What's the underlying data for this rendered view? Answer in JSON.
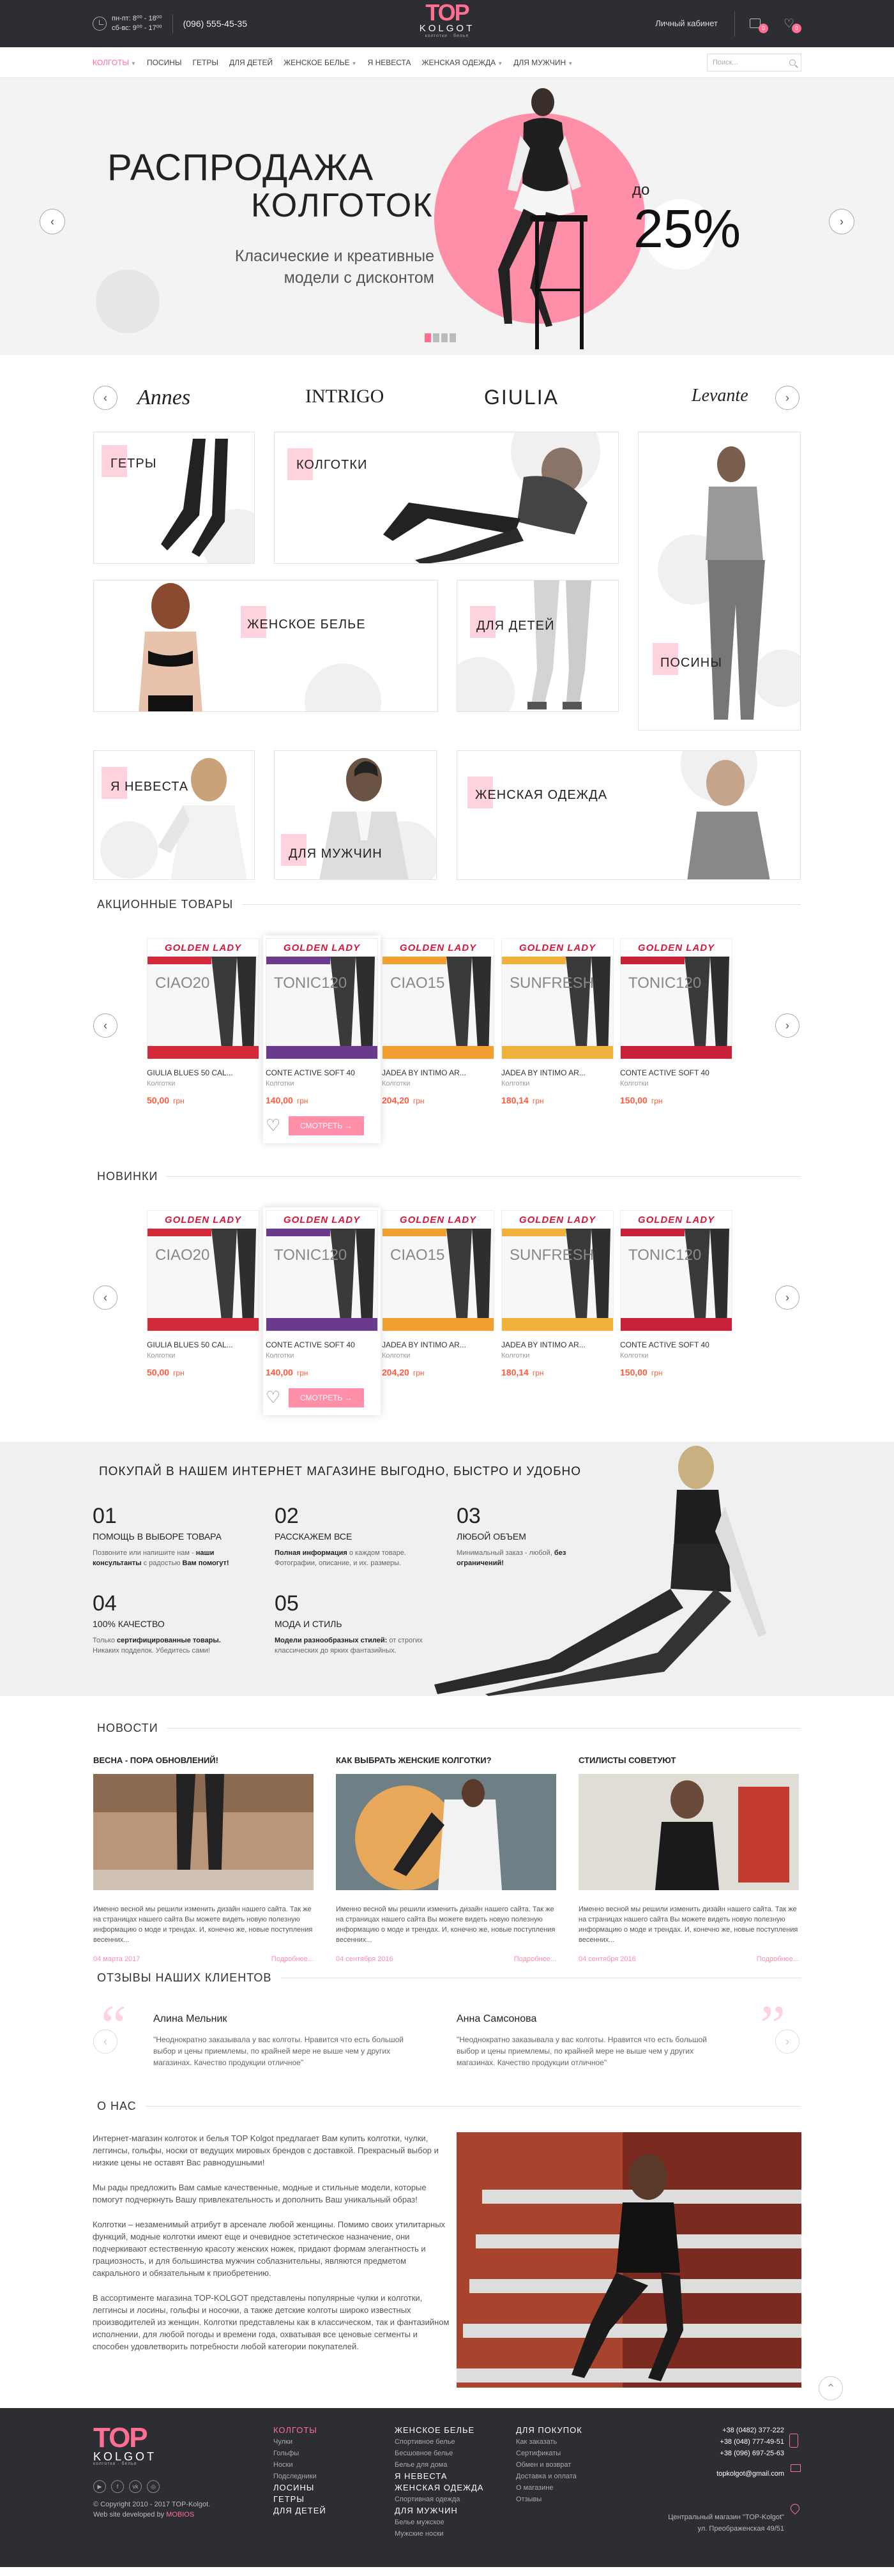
{
  "header": {
    "hours_line1": "пн-пт: 8⁰⁰ - 18⁰⁰",
    "hours_line2": "сб-вс: 9⁰⁰ - 17⁰⁰",
    "phone": "(096) 555-45-35",
    "logo_top": "TOP",
    "logo_mid": "KOLGOT",
    "logo_sub": "колготки · белье",
    "cabinet": "Личный кабинет",
    "cart_count": "0",
    "fav_count": "0"
  },
  "nav": {
    "items": [
      {
        "label": "колготы",
        "active": true,
        "dropdown": true
      },
      {
        "label": "посины",
        "active": false,
        "dropdown": false
      },
      {
        "label": "гетры",
        "active": false,
        "dropdown": false
      },
      {
        "label": "для детей",
        "active": false,
        "dropdown": false
      },
      {
        "label": "женское белье",
        "active": false,
        "dropdown": true
      },
      {
        "label": "я невеста",
        "active": false,
        "dropdown": false
      },
      {
        "label": "женская одежда",
        "active": false,
        "dropdown": true
      },
      {
        "label": "для мужчин",
        "active": false,
        "dropdown": true
      }
    ],
    "search_placeholder": "Поиск..."
  },
  "hero": {
    "title1": "РАСПРОДАЖА",
    "title2": "КОЛГОТОК",
    "subtitle1": "Класические и креативные",
    "subtitle2": "модели с дисконтом",
    "do": "до",
    "percent": "25%"
  },
  "brands": [
    "Annes",
    "INTRIGO",
    "GIULIA",
    "Levante"
  ],
  "categories": {
    "getry": "гетры",
    "kolgotki": "колготки",
    "posiny": "посины",
    "belie": "женское белье",
    "deti": "для детей",
    "nevesta": "я невеста",
    "muzh": "для мужчин",
    "odezhda": "женская одежда"
  },
  "sections": {
    "sale": "Акционные товары",
    "new": "Новинки",
    "why": "Покупай в нашем интернет магазине выгодно, быстро и удобно",
    "news": "Новости",
    "reviews": "Отзывы наших клиентов",
    "about": "О нас"
  },
  "products": [
    {
      "brand": "GOLDEN LADY",
      "model": "CIAO20",
      "name": "GIULIA BLUES 50 CAL...",
      "type": "Колготки",
      "price": "50,00",
      "currency": "грн",
      "color": "#d32b3c"
    },
    {
      "brand": "GOLDEN LADY",
      "model": "TONIC120",
      "name": "CONTE ACTIVE SOFT 40",
      "type": "Колготки",
      "price": "140,00",
      "currency": "грн",
      "color": "#6a3b8c"
    },
    {
      "brand": "GOLDEN LADY",
      "model": "CIAO15",
      "name": "JADEA BY INTIMO AR...",
      "type": "Колготки",
      "price": "204,20",
      "currency": "грн",
      "color": "#f0a030"
    },
    {
      "brand": "GOLDEN LADY",
      "model": "SUNFRESH",
      "name": "JADEA BY INTIMO AR...",
      "type": "Колготки",
      "price": "180,14",
      "currency": "грн",
      "color": "#f0b23a"
    },
    {
      "brand": "GOLDEN LADY",
      "model": "TONIC120",
      "name": "CONTE ACTIVE SOFT 40",
      "type": "Колготки",
      "price": "150,00",
      "currency": "грн",
      "color": "#c8223a"
    }
  ],
  "product_action": {
    "view": "Смотреть →"
  },
  "why": {
    "steps": [
      {
        "n": "01",
        "t": "Помощь в выборе товара",
        "d1": "Позвоните или напишите нам - ",
        "b1": "наши консультанты",
        "d2": " с радостью ",
        "b2": "Вам помогут!"
      },
      {
        "n": "02",
        "t": "Расскажем все",
        "d1": "",
        "b1": "Полная информация",
        "d2": " о каждом товаре. Фотографии, описание, и их. размеры.",
        "b2": ""
      },
      {
        "n": "03",
        "t": "Любой объем",
        "d1": "Минимальный заказ - любой, ",
        "b1": "без ограничений!",
        "d2": "",
        "b2": ""
      },
      {
        "n": "04",
        "t": "100% качество",
        "d1": "Только ",
        "b1": "сертифицированные товары.",
        "d2": " Никаких подделок. Убедитесь сами!",
        "b2": ""
      },
      {
        "n": "05",
        "t": "Мода и стиль",
        "d1": "",
        "b1": "Модели разнообразных стилей:",
        "d2": " от строгих классических до ярких фантазийных.",
        "b2": ""
      }
    ]
  },
  "news": [
    {
      "h": "Весна - пора обновлений!",
      "txt": "Именно весной мы решили изменить дизайн нашего сайта. Так же на страницах нашего сайта Вы можете видеть новую полезную информацию о моде и трендах. И, конечно же, новые поступления весенних...",
      "date": "04 марта 2017",
      "more": "Подробнее..."
    },
    {
      "h": "Как выбрать женские колготки?",
      "txt": "Именно весной мы решили изменить дизайн нашего сайта. Так же на страницах нашего сайта Вы можете видеть новую полезную информацию о моде и трендах. И, конечно же, новые поступления весенних...",
      "date": "04 сентября 2016",
      "more": "Подробнее..."
    },
    {
      "h": "Стилисты советуют",
      "txt": "Именно весной мы решили изменить дизайн нашего сайта. Так же на страницах нашего сайта Вы можете видеть новую полезную информацию о моде и трендах. И, конечно же, новые поступления весенних...",
      "date": "04 сентября 2016",
      "more": "Подробнее..."
    }
  ],
  "reviews": [
    {
      "name": "Алина Мельник",
      "text": "\"Неоднократно заказывала у вас колготы. Нравится что есть большой выбор и цены приемлемы, по крайней мере не выше чем у других магазинах. Качество продукции отличное\""
    },
    {
      "name": "Анна Самсонова",
      "text": "\"Неоднократно заказывала у вас колготы. Нравится что есть большой выбор и цены приемлемы, по крайней мере не выше чем у других магазинах. Качество продукции отличное\""
    }
  ],
  "about": {
    "p1": "Интернет-магазин колготок и белья TOP Kolgot предлагает Вам купить колготки, чулки, леггинсы, гольфы, носки от ведущих мировых брендов с доставкой. Прекрасный выбор и низкие цены не оставят Вас равнодушными!",
    "p2": "Мы рады предложить Вам самые качественные, модные и стильные модели, которые помогут подчеркнуть Вашу привлекательность и дополнить Ваш уникальный образ!",
    "p3": "Колготки – незаменимый атрибут в арсенале любой женщины. Помимо своих утилитарных функций, модные колготки имеют еще и очевидное эстетическое назначение, они подчеркивают естественную красоту женских ножек, придают формам элегантность и грациозность, и для большинства мужчин соблазнительны, являются предметом сакрального и обязательным к приобретению.",
    "p4": "В ассортименте магазина TOP-KOLGOT представлены популярные чулки и колготки, леггинсы и лосины, гольфы и носочки, а также детские колготы широко известных производителей из женщин. Колготки представлены как в классическом, так и фантазийном исполнении, для любой погоды и времени года, охватывая все ценовые сегменты и способен удовлетворить потребности любой категории покупателей."
  },
  "footer": {
    "copyright": "© Copyright 2010 - 2017 TOP-Kolgot.",
    "developed": "Web site developed by",
    "dev_name": "MOBIOS",
    "col1": [
      {
        "h": "Колготы",
        "pk": true,
        "subs": [
          "Чулки",
          "Гольфы",
          "Носки",
          "Подследники"
        ]
      },
      {
        "h": "Лосины",
        "pk": false,
        "subs": []
      },
      {
        "h": "Гетры",
        "pk": false,
        "subs": []
      },
      {
        "h": "Для детей",
        "pk": false,
        "subs": []
      }
    ],
    "col2": [
      {
        "h": "Женское белье",
        "subs": [
          "Спортивное белье",
          "Бесшовное белье",
          "Белье для дома"
        ]
      },
      {
        "h": "Я невеста",
        "subs": []
      },
      {
        "h": "Женская одежда",
        "subs": [
          "Спортивная одежда"
        ]
      },
      {
        "h": "Для мужчин",
        "subs": [
          "Белье мужское",
          "Мужские носки"
        ]
      }
    ],
    "col3_h": "Для покупок",
    "col3": [
      "Как заказать",
      "Сертификаты",
      "Обмен и возврат",
      "Доставка и оплата",
      "О магазине",
      "Отзывы"
    ],
    "phones": [
      "+38 (0482) 377-222",
      "+38 (048) 777-49-51",
      "+38 (096) 697-25-63"
    ],
    "email": "topkolgot@gmail.com",
    "shop": "Центральный магазин \"TOP-Kolgot\"",
    "address": "ул. Преображенская 49/51"
  }
}
